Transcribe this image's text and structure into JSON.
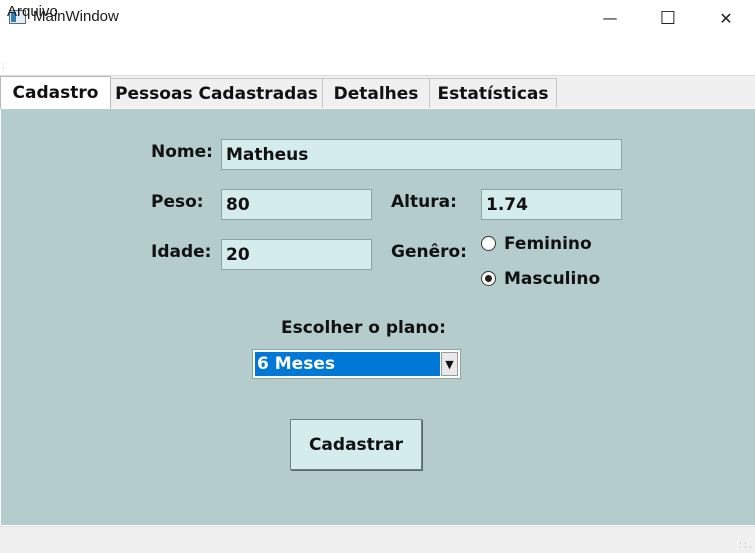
{
  "window": {
    "title": "MainWindow",
    "minimize": "—",
    "maximize": "☐",
    "close": "✕"
  },
  "menu": {
    "arquivo": "Arquivo"
  },
  "tabs": [
    {
      "label": "Cadastro"
    },
    {
      "label": "Pessoas Cadastradas"
    },
    {
      "label": "Detalhes"
    },
    {
      "label": "Estatísticas"
    }
  ],
  "form": {
    "nome_label": "Nome:",
    "nome_value": "Matheus",
    "peso_label": "Peso:",
    "peso_value": "80",
    "altura_label": "Altura:",
    "altura_value": "1.74",
    "idade_label": "Idade:",
    "idade_value": "20",
    "genero_label": "Genêro:",
    "genero_options": [
      "Feminino",
      "Masculino"
    ],
    "genero_selected": "Masculino",
    "plano_label": "Escolher o plano:",
    "plano_value": "6 Meses",
    "submit_label": "Cadastrar"
  },
  "colors": {
    "panel": "#b4cccc",
    "field": "#d4eceb",
    "selection": "#0078d7"
  }
}
